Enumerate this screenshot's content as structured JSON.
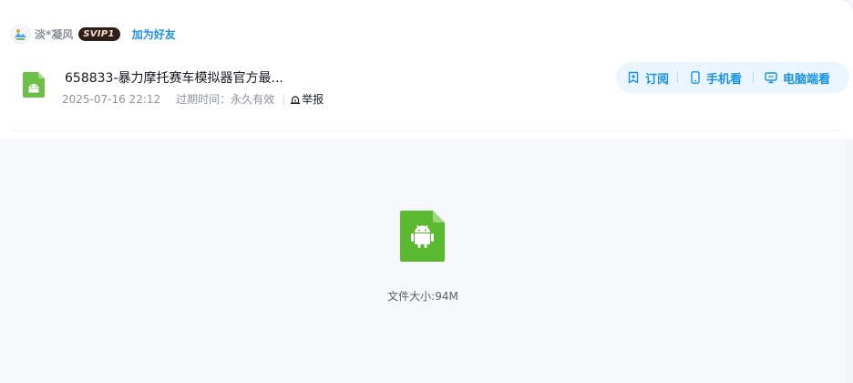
{
  "owner": {
    "name": "淡*凝风",
    "vip_badge": "SVIP1",
    "add_friend": "加为好友"
  },
  "file": {
    "title": "658833-暴力摩托赛车模拟器官方最...",
    "date": "2025-07-16 22:12",
    "expire": "过期时间：永久有效",
    "report": "举报",
    "size": "文件大小:94M",
    "icon": "android-apk-icon"
  },
  "actions": {
    "subscribe": "订阅",
    "mobile": "手机看",
    "pc": "电脑端看"
  },
  "colors": {
    "accent": "#1992e6",
    "apk_green": "#6cc04a",
    "apk_green_dark": "#5ab035"
  }
}
